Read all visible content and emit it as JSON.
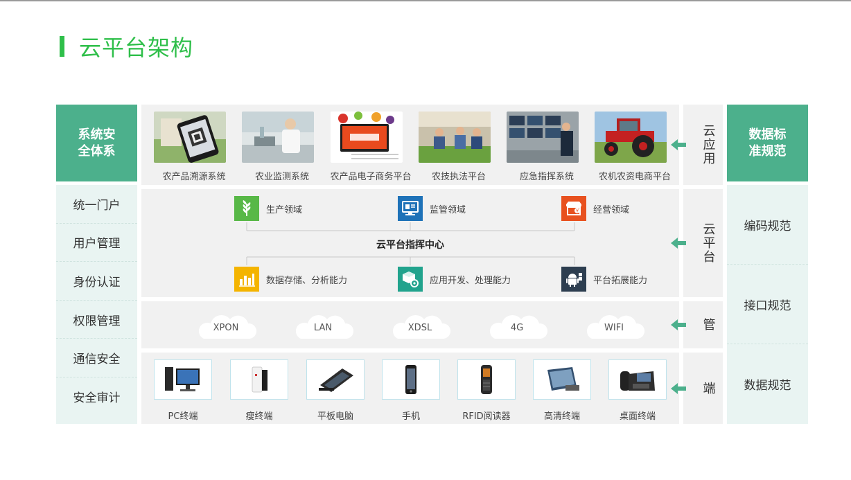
{
  "title": "云平台架构",
  "left": {
    "header_lines": [
      "系统安",
      "全体系"
    ],
    "items": [
      "统一门户",
      "用户管理",
      "身份认证",
      "权限管理",
      "通信安全",
      "安全审计"
    ]
  },
  "right": {
    "header_lines": [
      "数据标",
      "准规范"
    ],
    "items": [
      "编码规范",
      "接口规范",
      "数据规范"
    ]
  },
  "layers": {
    "app": {
      "label": "云应用"
    },
    "platform": {
      "label": "云平台"
    },
    "network": {
      "label": "管"
    },
    "terminal": {
      "label": "端"
    }
  },
  "apps": [
    {
      "label": "农产品溯源系统",
      "icon": "phone-scan-photo"
    },
    {
      "label": "农业监测系统",
      "icon": "lab-photo"
    },
    {
      "label": "农产品电子商务平台",
      "icon": "ecommerce-photo"
    },
    {
      "label": "农技执法平台",
      "icon": "market-photo"
    },
    {
      "label": "应急指挥系统",
      "icon": "control-room-photo"
    },
    {
      "label": "农机农资电商平台",
      "icon": "tractor-photo"
    }
  ],
  "platform": {
    "center": "云平台指挥中心",
    "top": [
      {
        "label": "生产领域",
        "icon": "wheat-icon",
        "color": "#58b847"
      },
      {
        "label": "监管领域",
        "icon": "monitor-icon",
        "color": "#1e72b8"
      },
      {
        "label": "经营领域",
        "icon": "shop-icon",
        "color": "#e8511f"
      }
    ],
    "bottom": [
      {
        "label": "数据存储、分析能力",
        "icon": "chart-icon",
        "color": "#f4b400"
      },
      {
        "label": "应用开发、处理能力",
        "icon": "cube-gear-icon",
        "color": "#21a38d"
      },
      {
        "label": "平台拓展能力",
        "icon": "android-icon",
        "color": "#2d3e50"
      }
    ]
  },
  "network": [
    "XPON",
    "LAN",
    "XDSL",
    "4G",
    "WIFI"
  ],
  "terminals": [
    {
      "label": "PC终端",
      "icon": "pc-icon"
    },
    {
      "label": "瘦终端",
      "icon": "thin-client-icon"
    },
    {
      "label": "平板电脑",
      "icon": "tablet-pc-icon"
    },
    {
      "label": "手机",
      "icon": "phone-icon"
    },
    {
      "label": "RFID阅读器",
      "icon": "rfid-reader-icon"
    },
    {
      "label": "高清终端",
      "icon": "hd-terminal-icon"
    },
    {
      "label": "桌面终端",
      "icon": "desk-phone-icon"
    }
  ],
  "colors": {
    "accent": "#2fbf4a",
    "header": "#4cb08c",
    "panel": "#f1f1f1",
    "side": "#e9f4f2",
    "arrow": "#4cb08c"
  }
}
